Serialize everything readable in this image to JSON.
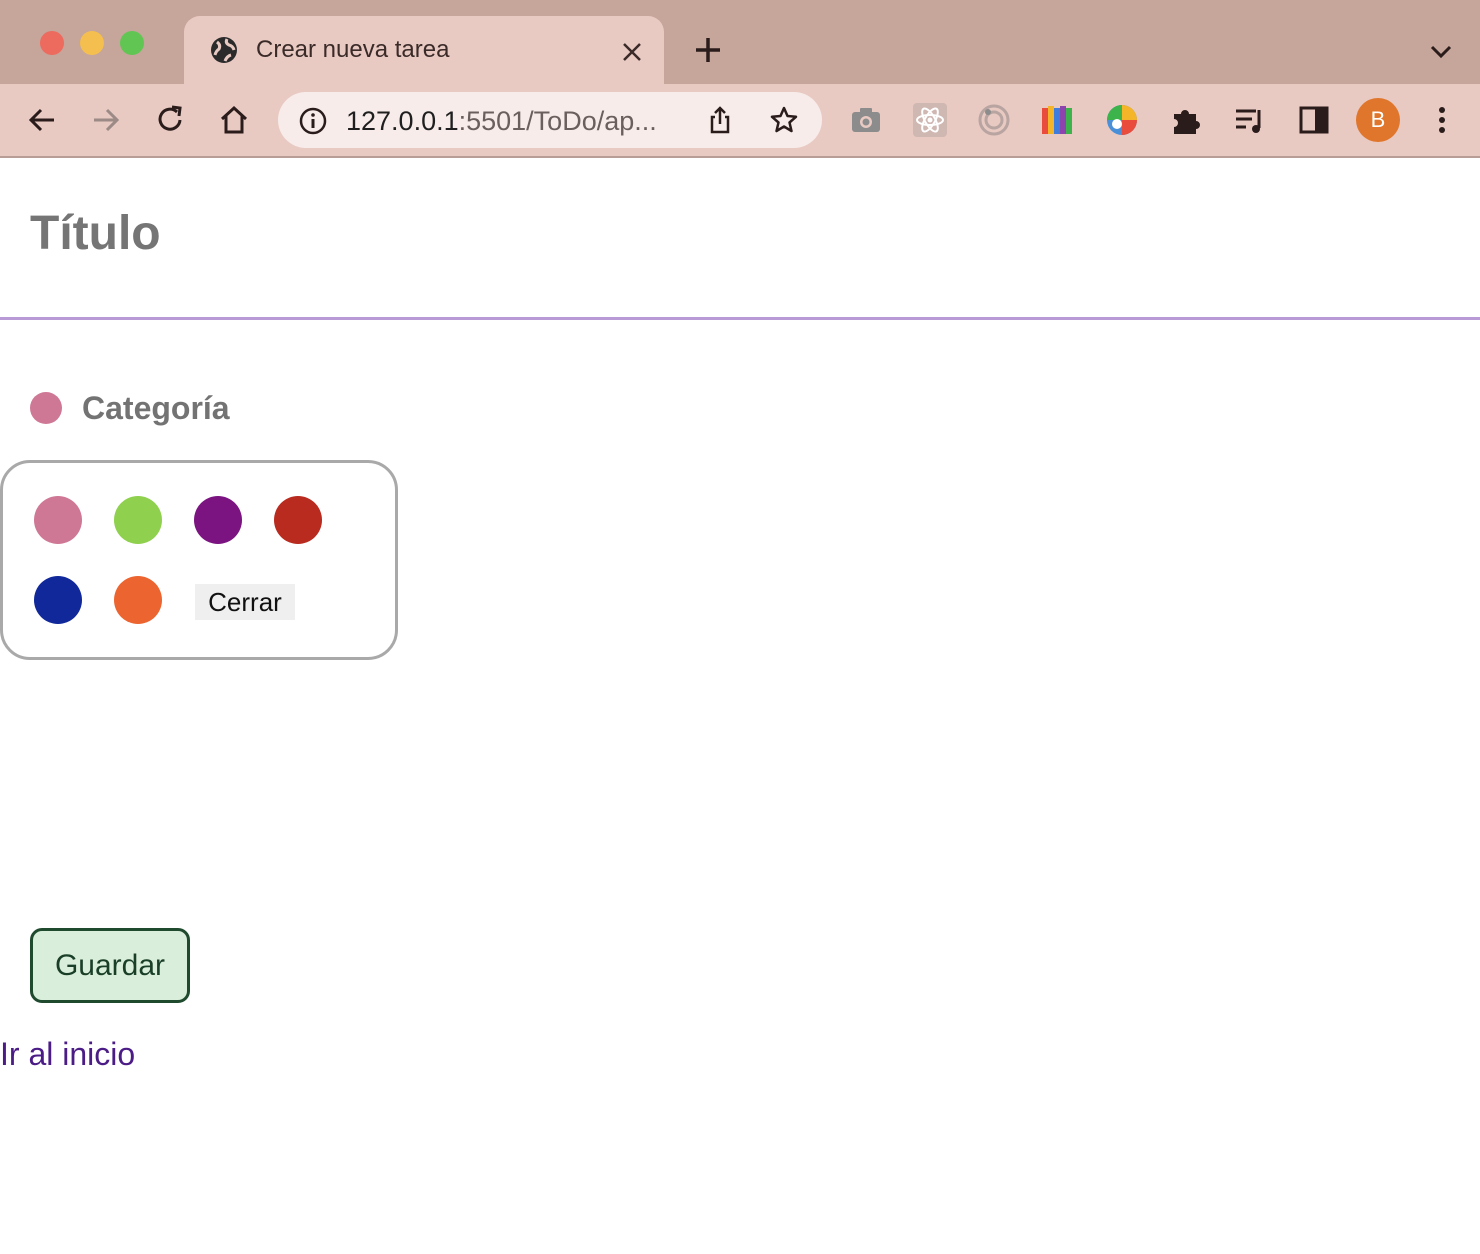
{
  "browser": {
    "tab_title": "Crear nueva tarea",
    "url_host": "127.0.0.1",
    "url_path": ":5501/ToDo/ap...",
    "profile_initial": "B"
  },
  "form": {
    "title_placeholder": "Título",
    "category_label": "Categoría",
    "selected_category_color": "#cf7895",
    "color_options": [
      "#cf7895",
      "#8fd04e",
      "#7b1480",
      "#b92a1f",
      "#10289a",
      "#ec6530"
    ],
    "close_label": "Cerrar",
    "save_label": "Guardar",
    "home_link": "Ir al inicio"
  }
}
